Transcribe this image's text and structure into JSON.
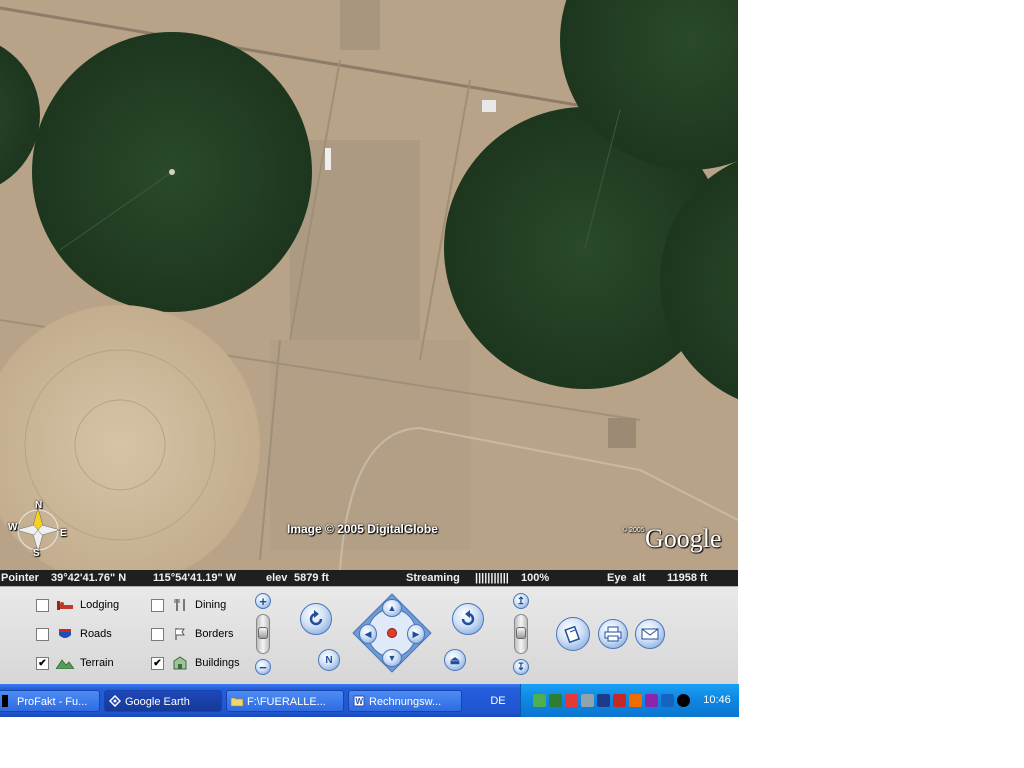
{
  "map": {
    "attribution": "Image © 2005 DigitalGlobe",
    "logo": "Google",
    "logo_year": "© 2005",
    "compass": {
      "n": "N",
      "s": "S",
      "e": "E",
      "w": "W"
    }
  },
  "status": {
    "pointer_label": "Pointer",
    "lat": "39°42'41.76\" N",
    "lon": "115°54'41.19\" W",
    "elev_label": "elev",
    "elev": "5879 ft",
    "streaming_label": "Streaming",
    "streaming_bar": "|||||||||||",
    "streaming_pct": "100%",
    "eye_label": "Eye  alt",
    "eye_alt": "11958 ft"
  },
  "layers": [
    {
      "label": "Lodging",
      "checked": false,
      "icon": "bed-icon"
    },
    {
      "label": "Roads",
      "checked": false,
      "icon": "interstate-shield-icon"
    },
    {
      "label": "Terrain",
      "checked": true,
      "icon": "mountain-icon"
    },
    {
      "label": "Dining",
      "checked": false,
      "icon": "fork-knife-icon"
    },
    {
      "label": "Borders",
      "checked": false,
      "icon": "flag-icon"
    },
    {
      "label": "Buildings",
      "checked": true,
      "icon": "building-icon"
    }
  ],
  "checkmark": "✔",
  "controls": {
    "zoom_in": "+",
    "zoom_out": "−",
    "north": "N",
    "tilt_top": "↥",
    "tilt_bottom": "↧"
  },
  "taskbar": {
    "tasks": [
      {
        "label": "ProFakt - Fu...",
        "icon": "app-icon"
      },
      {
        "label": "Google Earth",
        "icon": "google-earth-icon",
        "active": true
      },
      {
        "label": "F:\\FUERALLE...",
        "icon": "folder-icon"
      },
      {
        "label": "Rechnungsw...",
        "icon": "word-doc-icon"
      }
    ],
    "language": "DE",
    "clock": "10:46"
  },
  "colors": {
    "field_dark": "#223d22",
    "field_dry": "#c8b497",
    "desert": "#b9a48b",
    "taskbar": "#245edb",
    "tray": "#0f86e0"
  }
}
